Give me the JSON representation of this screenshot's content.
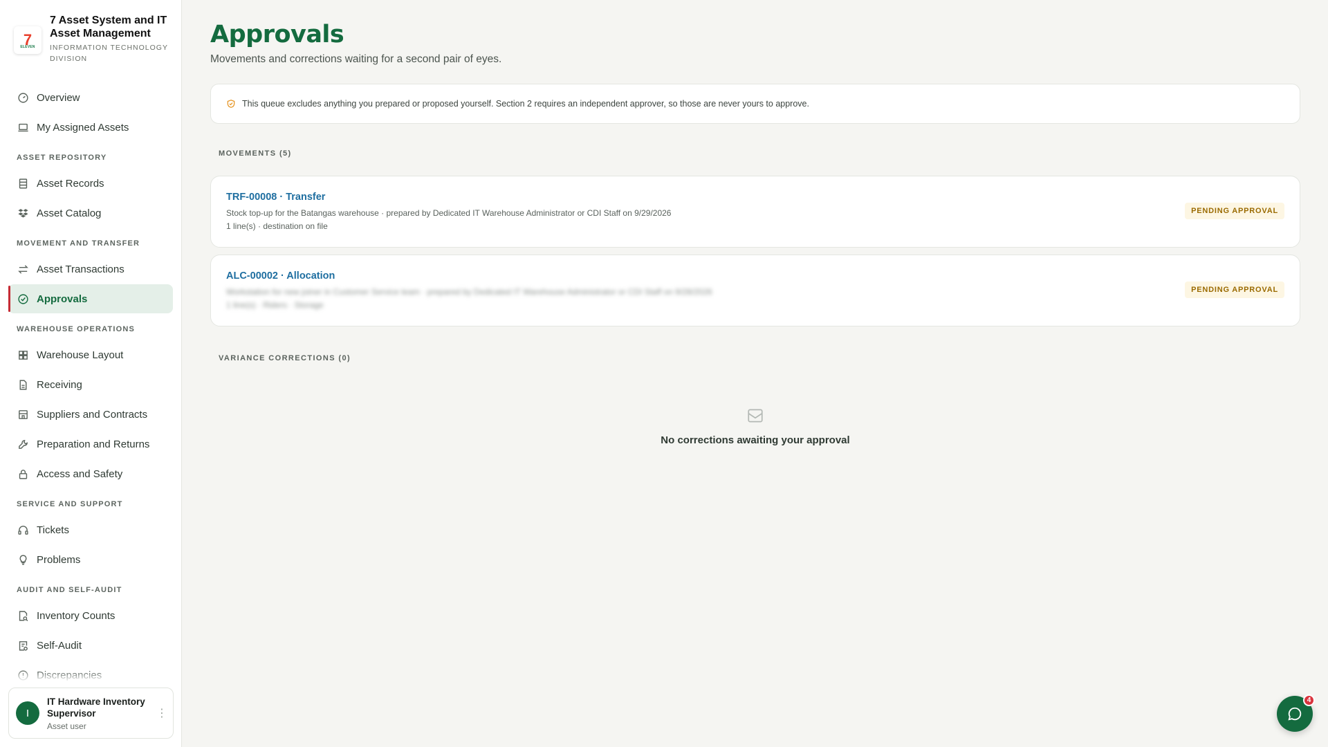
{
  "brand": {
    "title": "7 Asset System and IT Asset Management",
    "subtitle": "INFORMATION TECHNOLOGY DIVISION",
    "logo_text": "7",
    "logo_subtext": "ELEVEN"
  },
  "sidebar": {
    "top_items": [
      {
        "label": "Overview",
        "icon": "gauge-icon"
      },
      {
        "label": "My Assigned Assets",
        "icon": "laptop-icon"
      }
    ],
    "sections": [
      {
        "title": "ASSET REPOSITORY",
        "items": [
          {
            "label": "Asset Records",
            "icon": "records-icon"
          },
          {
            "label": "Asset Catalog",
            "icon": "dropbox-icon"
          }
        ]
      },
      {
        "title": "MOVEMENT AND TRANSFER",
        "items": [
          {
            "label": "Asset Transactions",
            "icon": "arrows-icon"
          },
          {
            "label": "Approvals",
            "icon": "check-circle-icon",
            "active": true
          }
        ]
      },
      {
        "title": "WAREHOUSE OPERATIONS",
        "items": [
          {
            "label": "Warehouse Layout",
            "icon": "grid-icon"
          },
          {
            "label": "Receiving",
            "icon": "document-icon"
          },
          {
            "label": "Suppliers and Contracts",
            "icon": "store-icon"
          },
          {
            "label": "Preparation and Returns",
            "icon": "wrench-icon"
          },
          {
            "label": "Access and Safety",
            "icon": "lock-icon"
          }
        ]
      },
      {
        "title": "SERVICE AND SUPPORT",
        "items": [
          {
            "label": "Tickets",
            "icon": "headset-icon"
          },
          {
            "label": "Problems",
            "icon": "lightbulb-icon"
          }
        ]
      },
      {
        "title": "AUDIT AND SELF-AUDIT",
        "items": [
          {
            "label": "Inventory Counts",
            "icon": "search-doc-icon"
          },
          {
            "label": "Self-Audit",
            "icon": "clipboard-icon"
          },
          {
            "label": "Discrepancies",
            "icon": "alert-icon"
          }
        ]
      }
    ]
  },
  "user": {
    "initial": "I",
    "name": "IT Hardware Inventory Supervisor",
    "role": "Asset user"
  },
  "page": {
    "title": "Approvals",
    "subtitle": "Movements and corrections waiting for a second pair of eyes."
  },
  "notice": {
    "text": "This queue excludes anything you prepared or proposed yourself. Section 2 requires an independent approver, so those are never yours to approve."
  },
  "movements": {
    "label": "MOVEMENTS (5)",
    "cards": [
      {
        "title": "TRF-00008 · Transfer",
        "line1": "Stock top-up for the Batangas warehouse · prepared by Dedicated IT Warehouse Administrator or CDI Staff on 9/29/2026",
        "line2": "1 line(s) · destination on file",
        "badge": "PENDING APPROVAL"
      },
      {
        "title": "ALC-00002 · Allocation",
        "line1": "Workstation for new joiner in Customer Service team · prepared by Dedicated IT Warehouse Administrator or CDI Staff on 9/28/2026",
        "line2": "1 line(s) · Riders · Storage",
        "badge": "PENDING APPROVAL"
      }
    ]
  },
  "variance": {
    "label": "VARIANCE CORRECTIONS (0)",
    "empty_text": "No corrections awaiting your approval",
    "empty_icon": "inbox-icon"
  },
  "chat": {
    "icon": "chat-icon",
    "badge": "4"
  },
  "colors": {
    "brand_green": "#146b3f",
    "link_blue": "#1e6ea0",
    "badge_gold": "#9a6a00",
    "active_marker": "#c62b35"
  }
}
